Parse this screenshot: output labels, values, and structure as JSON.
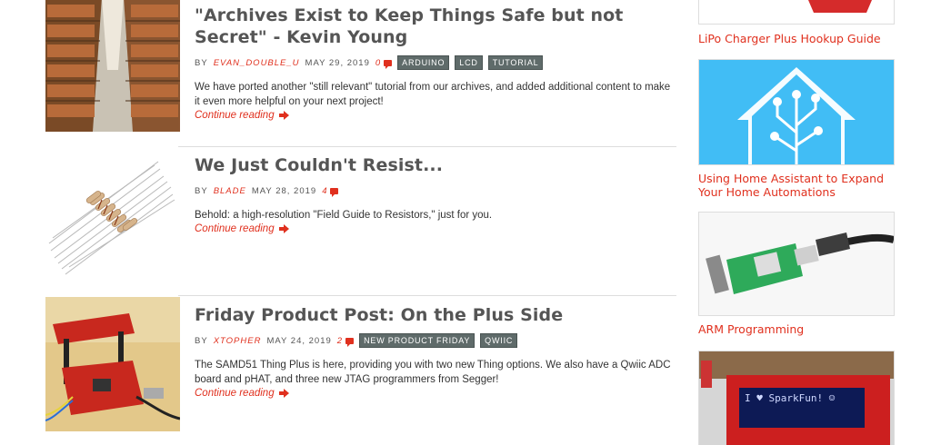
{
  "posts": [
    {
      "title": "\"Archives Exist to Keep Things Safe but not Secret\" - Kevin Young",
      "by": "BY",
      "author": "EVAN_DOUBLE_U",
      "date": "MAY 29, 2019",
      "comments": "0",
      "tags": [
        "ARDUINO",
        "LCD",
        "TUTORIAL"
      ],
      "excerpt": "We have ported another \"still relevant\" tutorial from our archives, and added additional content to make it even more helpful on your next project!",
      "more": "Continue reading"
    },
    {
      "title": "We Just Couldn't Resist...",
      "by": "BY",
      "author": "BLADE",
      "date": "MAY 28, 2019",
      "comments": "4",
      "tags": [],
      "excerpt": "Behold: a high-resolution \"Field Guide to Resistors,\" just for you.",
      "more": "Continue reading"
    },
    {
      "title": "Friday Product Post: On the Plus Side",
      "by": "BY",
      "author": "XTOPHER",
      "date": "MAY 24, 2019",
      "comments": "2",
      "tags": [
        "NEW PRODUCT FRIDAY",
        "QWIIC"
      ],
      "excerpt": "The SAMD51 Thing Plus is here, providing you with two new Thing options. We also have a Qwiic ADC board and pHAT, and three new JTAG programmers from Segger!",
      "more": "Continue reading"
    }
  ],
  "sidebar": [
    {
      "title": "LiPo Charger Plus Hookup Guide"
    },
    {
      "title": "Using Home Assistant to Expand Your Home Automations"
    },
    {
      "title": "ARM Programming"
    },
    {
      "lcd_text": "I ♥ SparkFun! ☺"
    }
  ],
  "colors": {
    "accent": "#e0301e",
    "tag_bg": "#5f6b6a",
    "home_blue": "#41bdf5"
  }
}
